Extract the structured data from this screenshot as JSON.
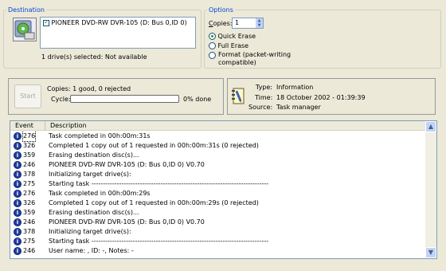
{
  "destination": {
    "legend": "Destination",
    "drive_label": "PIONEER DVD-RW  DVR-105 (D: Bus 0,ID 0)",
    "drive_checked": true,
    "status": "1 drive(s) selected: Not available"
  },
  "options": {
    "legend": "Options",
    "copies_label": "Copies:",
    "copies_value": "1",
    "radios": [
      {
        "label": "Quick Erase",
        "selected": true
      },
      {
        "label": "Full Erase",
        "selected": false
      },
      {
        "label": "Format (packet-writing compatible)",
        "selected": false
      }
    ]
  },
  "progress": {
    "start_label": "Start",
    "copies_text": "Copies: 1 good, 0 rejected",
    "cycle_label": "Cycle:",
    "percent_text": "0% done",
    "percent": 0
  },
  "info": {
    "type_label": "Type:",
    "type_value": "Information",
    "time_label": "Time:",
    "time_value": "18 October 2002 - 01:39:39",
    "source_label": "Source:",
    "source_value": "Task manager"
  },
  "log": {
    "col_event": "Event",
    "col_description": "Description",
    "rows": [
      {
        "event": "276",
        "description": "Task completed in 00h:00m:31s"
      },
      {
        "event": "326",
        "description": "Completed 1 copy out of 1 requested in 00h:00m:31s (0 rejected)"
      },
      {
        "event": "359",
        "description": "Erasing destination disc(s)..."
      },
      {
        "event": "246",
        "description": "PIONEER DVD-RW  DVR-105 (D: Bus 0,ID 0) V0.70"
      },
      {
        "event": "378",
        "description": "Initializing target drive(s):"
      },
      {
        "event": "275",
        "description": "Starting task -----------------------------------------------------------------------------"
      },
      {
        "event": "276",
        "description": "Task completed in 00h:00m:29s"
      },
      {
        "event": "326",
        "description": "Completed 1 copy out of 1 requested in 00h:00m:29s (0 rejected)"
      },
      {
        "event": "359",
        "description": "Erasing destination disc(s)..."
      },
      {
        "event": "246",
        "description": "PIONEER DVD-RW  DVR-105 (D: Bus 0,ID 0) V0.70"
      },
      {
        "event": "378",
        "description": "Initializing target drive(s):"
      },
      {
        "event": "275",
        "description": "Starting task -----------------------------------------------------------------------------"
      },
      {
        "event": "246",
        "description": "User name: ,                                   ID: -, Notes: -"
      }
    ]
  },
  "colors": {
    "window_bg": "#ece9d8",
    "accent": "#0046d5",
    "scroll": "#c1d3fb"
  }
}
